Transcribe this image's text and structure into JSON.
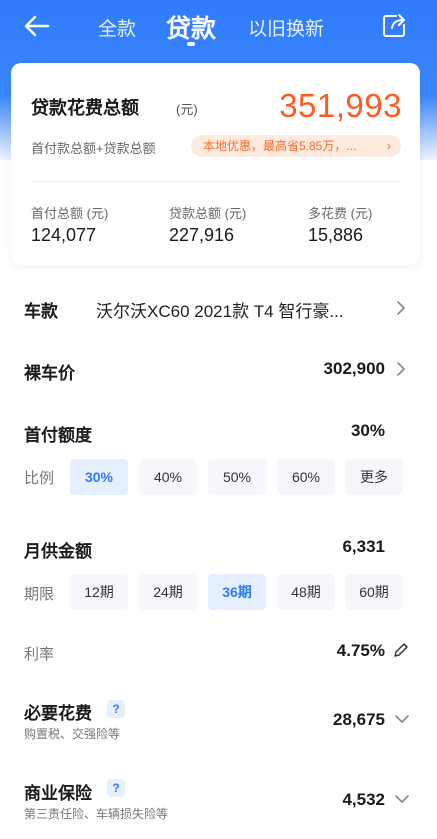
{
  "header": {
    "tabs": [
      "全款",
      "贷款",
      "以旧换新"
    ],
    "active_tab": "贷款"
  },
  "summary": {
    "title": "贷款花费总额",
    "unit": "(元)",
    "total": "351,993",
    "subtitle": "首付款总额+贷款总额",
    "promo": "本地优惠，最高省5.85万，...",
    "stats": [
      {
        "label": "首付总额 (元)",
        "value": "124,077"
      },
      {
        "label": "贷款总额 (元)",
        "value": "227,916"
      },
      {
        "label": "多花费 (元)",
        "value": "15,886"
      }
    ]
  },
  "model": {
    "label": "车款",
    "value": "沃尔沃XC60 2021款 T4 智行豪..."
  },
  "price": {
    "label": "裸车价",
    "value": "302,900"
  },
  "down": {
    "label": "首付额度",
    "value": "30%",
    "ratio_label": "比例",
    "options": [
      "30%",
      "40%",
      "50%",
      "60%",
      "更多"
    ],
    "selected": "30%"
  },
  "monthly": {
    "label": "月供金额",
    "value": "6,331",
    "term_label": "期限",
    "options": [
      "12期",
      "24期",
      "36期",
      "48期",
      "60期"
    ],
    "selected": "36期"
  },
  "rate": {
    "label": "利率",
    "value": "4.75%"
  },
  "required": {
    "label": "必要花费",
    "note": "购置税、交强险等",
    "value": "28,675"
  },
  "insurance": {
    "label": "商业保险",
    "note": "第三责任险、车辆损失险等",
    "value": "4,532"
  },
  "colors": {
    "primary": "#2f7bfb",
    "accent": "#ff5a1f",
    "chip_active_bg": "#e5effe"
  }
}
